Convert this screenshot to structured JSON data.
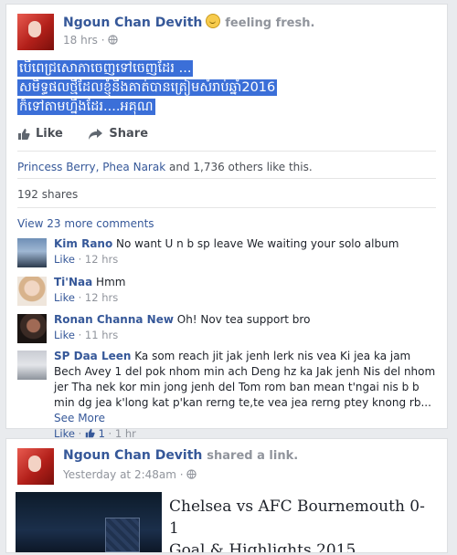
{
  "post": {
    "author": "Ngoun Chan Devith",
    "feeling": "feeling fresh.",
    "time": "18 hrs",
    "text_lines": [
      "បើពេជ្រសោភាចេញទៅចេញដែរ ...",
      "សមិទ្ធផលថ្មីដែលខ្ញុំនឹងគាត់បានត្រៀមសំរាប់ឆ្នាំ2016",
      "ក៏ទៅតាមហ្នឹងដែរ....អគុណ"
    ],
    "like_label": "Like",
    "share_label": "Share",
    "likes_names": "Princess Berry, Phea Narak",
    "likes_rest": " and 1,736 others like this.",
    "shares": "192 shares",
    "view_more": "View 23 more comments"
  },
  "comments": [
    {
      "name": "Kim Rano",
      "text": "No want U n b sp leave We waiting your solo album",
      "like": "Like",
      "time": "12 hrs"
    },
    {
      "name": "Ti'Naa",
      "text": "Hmm",
      "like": "Like",
      "time": "12 hrs"
    },
    {
      "name": "Ronan Channa New",
      "text": "Oh! Nov tea support bro",
      "like": "Like",
      "time": "11 hrs"
    },
    {
      "name": "SP Daa Leen",
      "text": "Ka som reach jit jak jenh lerk nis vea Ki jea ka jam Bech Avey 1 del pok nhom min ach Deng hz ka Jak jenh Nis del nhom jer Tha nek kor min jong jenh del Tom rom ban mean t'ngai nis b b min dg jea k'long kat p'kan rerng te,te vea jea rerng ptey knong rb...",
      "see_more": "See More",
      "like": "Like",
      "likes_count": "1",
      "time": "1 hr"
    }
  ],
  "post2": {
    "author": "Ngoun Chan Devith",
    "action": "shared a link.",
    "time": "Yesterday at 2:48am",
    "link_title_line1": "Chelsea vs AFC Bournemouth 0-1",
    "link_title_line2": "Goal & Highlights 2015"
  }
}
